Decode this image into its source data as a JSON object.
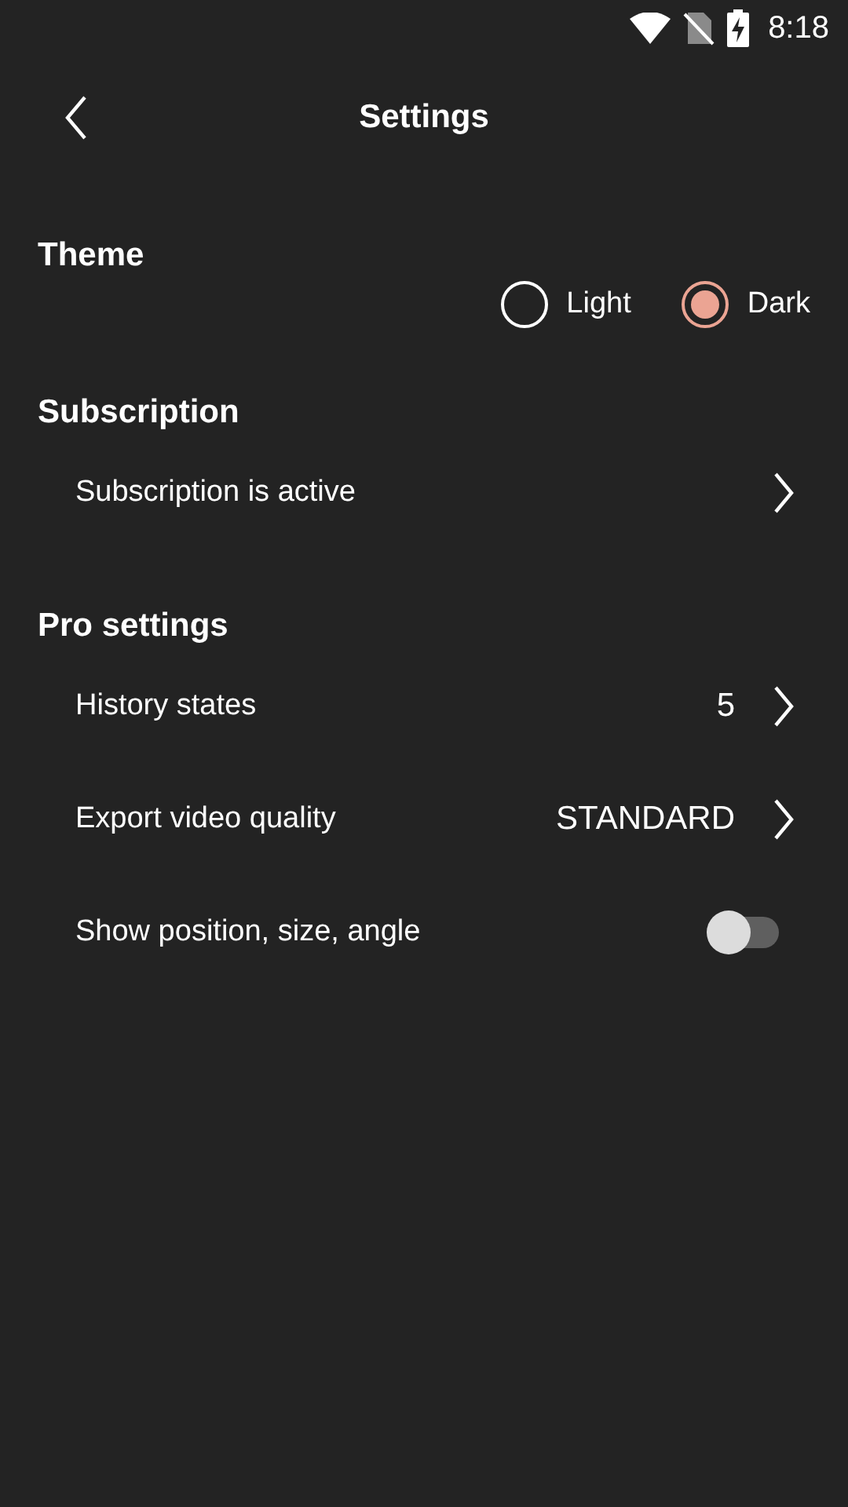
{
  "status_bar": {
    "time": "8:18"
  },
  "header": {
    "title": "Settings"
  },
  "sections": [
    {
      "title": "Theme",
      "items": [
        {
          "kind": "radio_group",
          "options": [
            {
              "label": "Light",
              "selected": false
            },
            {
              "label": "Dark",
              "selected": true
            }
          ]
        }
      ]
    },
    {
      "title": "Subscription",
      "items": [
        {
          "kind": "link",
          "label": "Subscription is active"
        }
      ]
    },
    {
      "title": "Pro settings",
      "items": [
        {
          "kind": "link",
          "label": "History states",
          "value": "5"
        },
        {
          "kind": "link",
          "label": "Export video quality",
          "value": "STANDARD"
        },
        {
          "kind": "toggle",
          "label": "Show position, size, angle",
          "on": false
        }
      ]
    }
  ]
}
